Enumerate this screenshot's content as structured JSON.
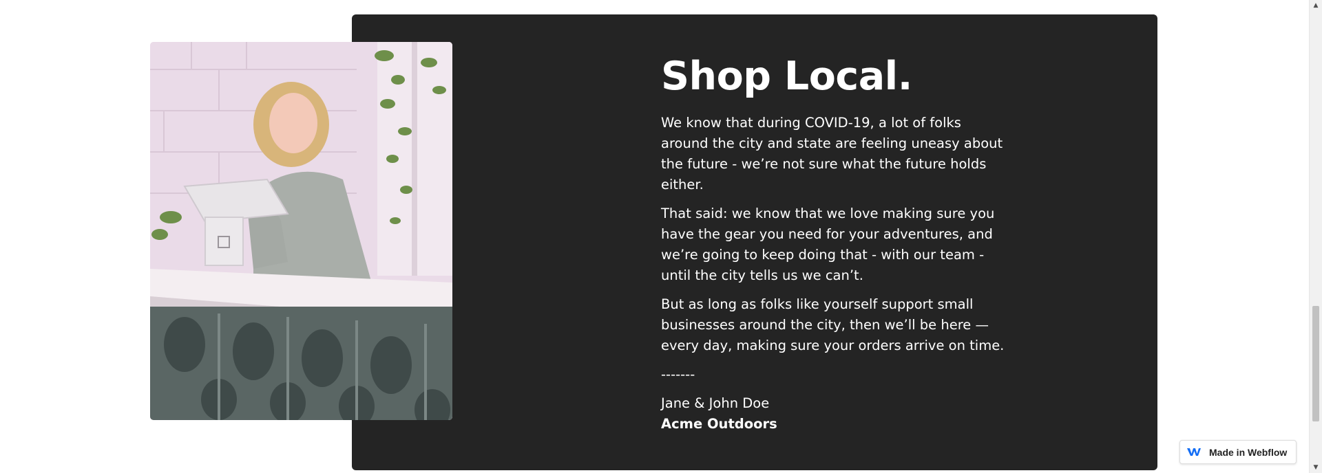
{
  "section": {
    "heading": "Shop Local.",
    "paragraphs": [
      "We know that during COVID-19, a lot of folks around the city and state are feeling uneasy about the future - we’re not sure what the future holds either.",
      "That said: we know that we love making sure you have the gear you need for your adventures, and we’re going to keep doing that - with our team - until the city tells us we can’t.",
      "But as long as folks like yourself support small businesses around the city, then we’ll be here — every day, making sure your orders arrive on time."
    ],
    "divider": "-------",
    "signature_name": "Jane & John Doe",
    "signature_company": "Acme Outdoors"
  },
  "badge": {
    "label": "Made in Webflow",
    "icon": "webflow-logo-icon"
  },
  "colors": {
    "panel_bg": "#242424",
    "text": "#ffffff",
    "webflow_blue": "#146EF5"
  }
}
